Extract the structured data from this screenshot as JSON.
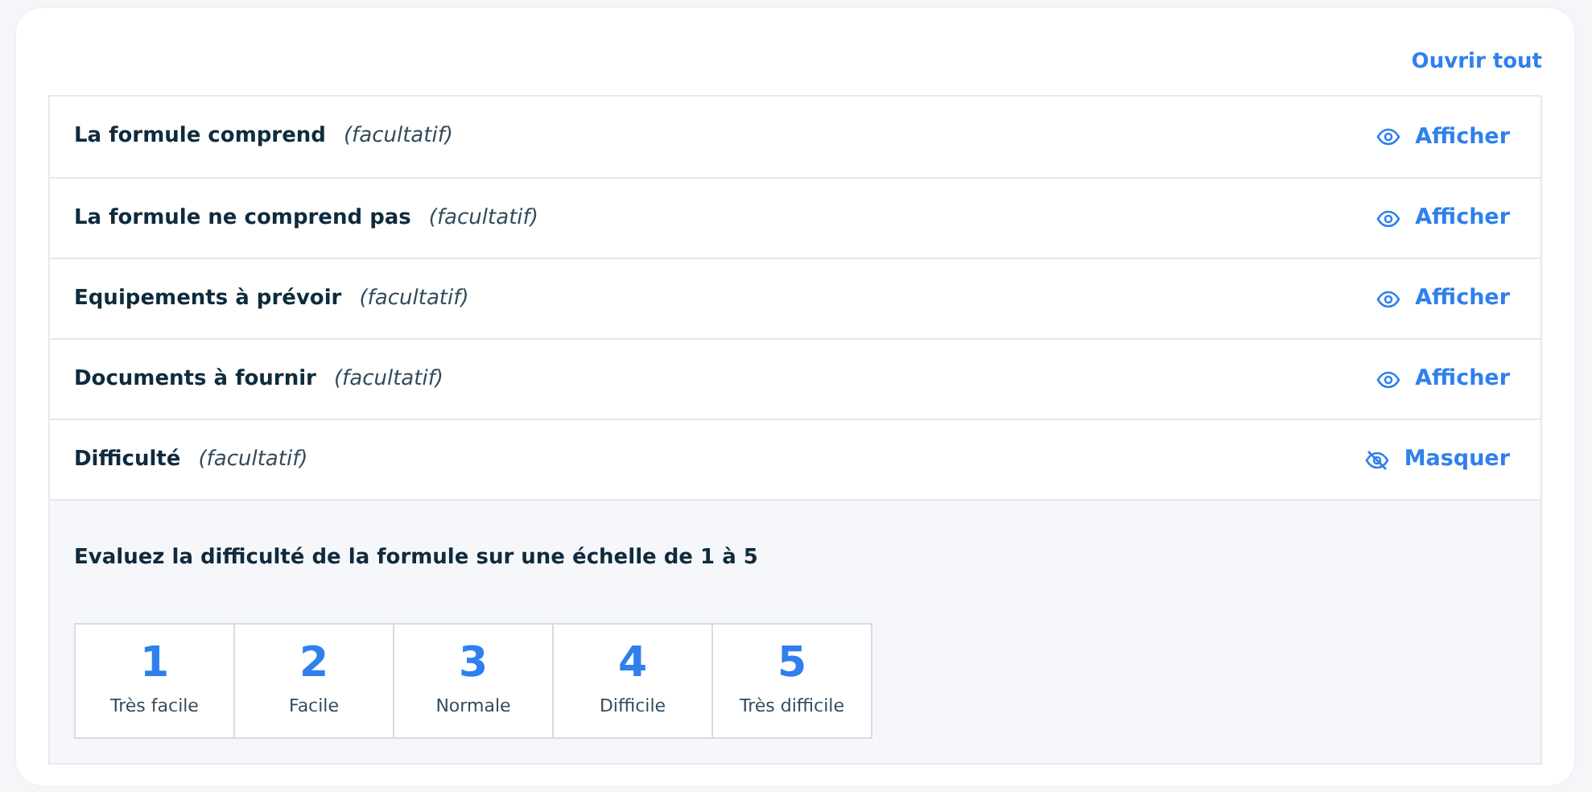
{
  "open_all": "Ouvrir tout",
  "sections": [
    {
      "title": "La formule comprend",
      "note": "(facultatif)",
      "expanded": false,
      "toggle": "Afficher"
    },
    {
      "title": "La formule ne comprend pas",
      "note": "(facultatif)",
      "expanded": false,
      "toggle": "Afficher"
    },
    {
      "title": "Equipements à prévoir",
      "note": "(facultatif)",
      "expanded": false,
      "toggle": "Afficher"
    },
    {
      "title": "Documents à fournir",
      "note": "(facultatif)",
      "expanded": false,
      "toggle": "Afficher"
    },
    {
      "title": "Difficulté",
      "note": "(facultatif)",
      "expanded": true,
      "toggle": "Masquer",
      "question": "Evaluez la difficulté de la formule sur une échelle de 1 à 5",
      "scale": [
        {
          "value": "1",
          "label": "Très facile"
        },
        {
          "value": "2",
          "label": "Facile"
        },
        {
          "value": "3",
          "label": "Normale"
        },
        {
          "value": "4",
          "label": "Difficile"
        },
        {
          "value": "5",
          "label": "Très difficile"
        }
      ]
    }
  ]
}
